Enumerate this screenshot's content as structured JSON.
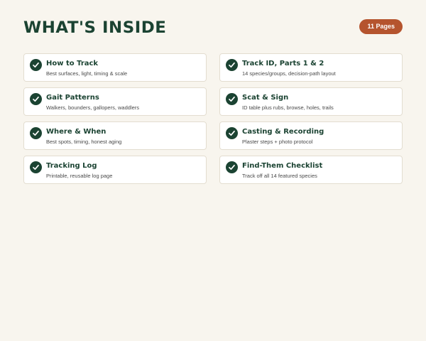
{
  "header": {
    "title": "WHAT'S INSIDE",
    "badge": "11 Pages"
  },
  "colors": {
    "background": "#f8f5ee",
    "primary_green": "#1b4332",
    "badge_orange": "#b5542e",
    "card_background": "#ffffff",
    "card_border": "#e3ddd0"
  },
  "items": [
    {
      "icon": "check-icon",
      "title": "How to Track",
      "description": "Best surfaces, light, timing & scale"
    },
    {
      "icon": "check-icon",
      "title": "Track ID, Parts 1 & 2",
      "description": "14 species/groups, decision-path layout"
    },
    {
      "icon": "check-icon",
      "title": "Gait Patterns",
      "description": "Walkers, bounders, gallopers, waddlers"
    },
    {
      "icon": "check-icon",
      "title": "Scat & Sign",
      "description": "ID table plus rubs, browse, holes, trails"
    },
    {
      "icon": "check-icon",
      "title": "Where & When",
      "description": "Best spots, timing, honest aging"
    },
    {
      "icon": "check-icon",
      "title": "Casting & Recording",
      "description": "Plaster steps + photo protocol"
    },
    {
      "icon": "check-icon",
      "title": "Tracking Log",
      "description": "Printable, reusable log page"
    },
    {
      "icon": "check-icon",
      "title": "Find-Them Checklist",
      "description": "Track off all 14 featured species"
    }
  ]
}
